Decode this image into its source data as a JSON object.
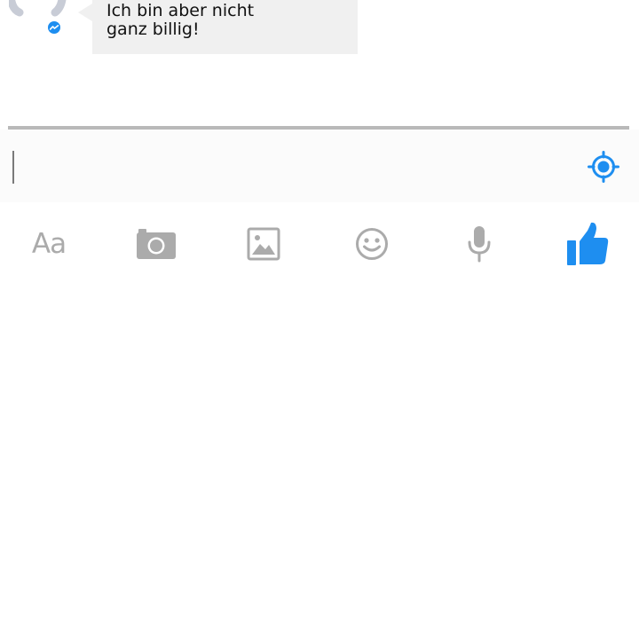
{
  "conversation": {
    "messages": [
      {
        "direction": "incoming",
        "text": "Ich bin aber nicht\nganz billig!"
      }
    ]
  },
  "composer": {
    "input_value": "",
    "placeholder": "",
    "location_icon": "location-target-icon"
  },
  "toolbar": {
    "text_style_label": "Aa",
    "icons": [
      "text-style-icon",
      "camera-icon",
      "image-gallery-icon",
      "emoji-icon",
      "microphone-icon",
      "thumbs-up-icon"
    ]
  },
  "colors": {
    "accent": "#1e8ef0",
    "bubble_background": "#f0f0f0",
    "icon_gray": "#ababab",
    "divider": "#b9b9b9"
  }
}
